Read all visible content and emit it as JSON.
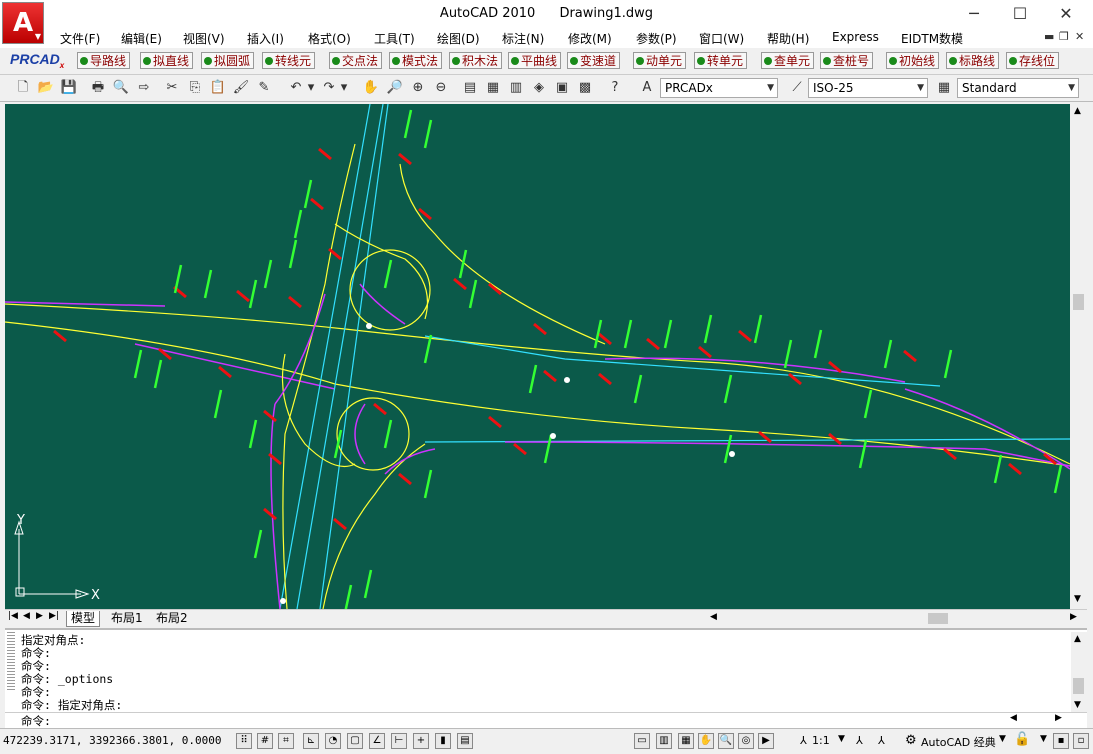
{
  "window": {
    "app_title": "AutoCAD 2010",
    "doc_title": "Drawing1.dwg",
    "minimize": "─",
    "maximize": "☐",
    "close": "✕"
  },
  "menu": [
    "文件(F)",
    "编辑(E)",
    "视图(V)",
    "插入(I)",
    "格式(O)",
    "工具(T)",
    "绘图(D)",
    "标注(N)",
    "修改(M)",
    "参数(P)",
    "窗口(W)",
    "帮助(H)",
    "Express",
    "EIDTM数模"
  ],
  "prcad": {
    "logo": "PRCAD",
    "logo_sub": "x",
    "buttons": [
      "导路线",
      "拟直线",
      "拟圆弧",
      "转线元",
      "交点法",
      "模式法",
      "积木法",
      "平曲线",
      "变速道",
      "动单元",
      "转单元",
      "查单元",
      "查桩号",
      "初始线",
      "标路线",
      "存线位"
    ]
  },
  "styles": {
    "text_style": "PRCADx",
    "dim_style": "ISO-25",
    "table_style": "Standard"
  },
  "tabs": [
    "模型",
    "布局1",
    "布局2"
  ],
  "command": {
    "history": [
      "指定对角点:",
      "命令:",
      "命令:",
      "命令: _options",
      "命令:",
      "命令: 指定对角点:"
    ],
    "prompt": "命令:"
  },
  "status": {
    "coords": "472239.3171, 3392366.3801, 0.0000",
    "scale": "1:1",
    "workspace": "AutoCAD 经典"
  },
  "ucs": {
    "x_label": "X",
    "y_label": "Y"
  },
  "colors": {
    "canvas": "#0b5a4a",
    "road_yellow": "#ffff33",
    "road_cyan": "#33e0ff",
    "road_magenta": "#cc33ff",
    "marker_red": "#ee1111",
    "label_green": "#33ff33"
  }
}
